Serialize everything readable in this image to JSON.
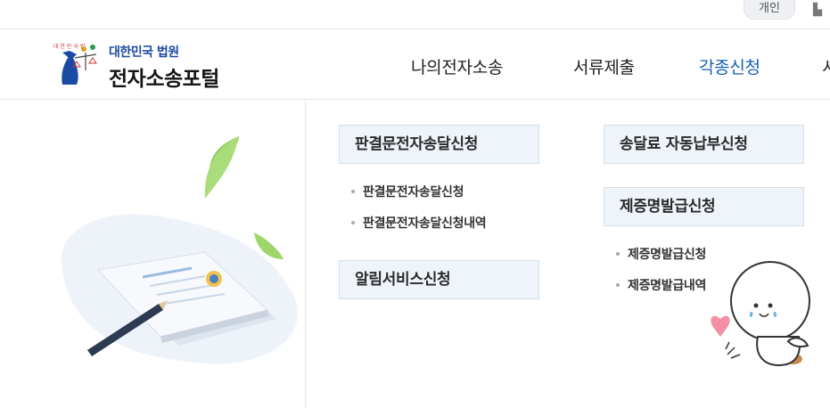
{
  "utility": {
    "user_type_label": "개인",
    "corner_glyph": "▙"
  },
  "logo": {
    "small_text": "대한민국 법원",
    "big_text": "전자소송포털"
  },
  "gnb": [
    {
      "label": "나의전자소송",
      "active": false
    },
    {
      "label": "서류제출",
      "active": false
    },
    {
      "label": "각종신청",
      "active": true
    },
    {
      "label": "시",
      "active": false
    }
  ],
  "menu": {
    "left": [
      {
        "title": "판결문전자송달신청",
        "items": [
          "판결문전자송달신청",
          "판결문전자송달신청내역"
        ]
      },
      {
        "title": "알림서비스신청",
        "items": []
      }
    ],
    "right": [
      {
        "title": "송달료 자동납부신청",
        "items": []
      },
      {
        "title": "제증명발급신청",
        "items": [
          "제증명발급신청",
          "제증명발급내역"
        ]
      }
    ]
  },
  "colors": {
    "accent": "#1560b3",
    "menu_bg": "#eef4fa",
    "menu_border": "#d6dee8"
  }
}
